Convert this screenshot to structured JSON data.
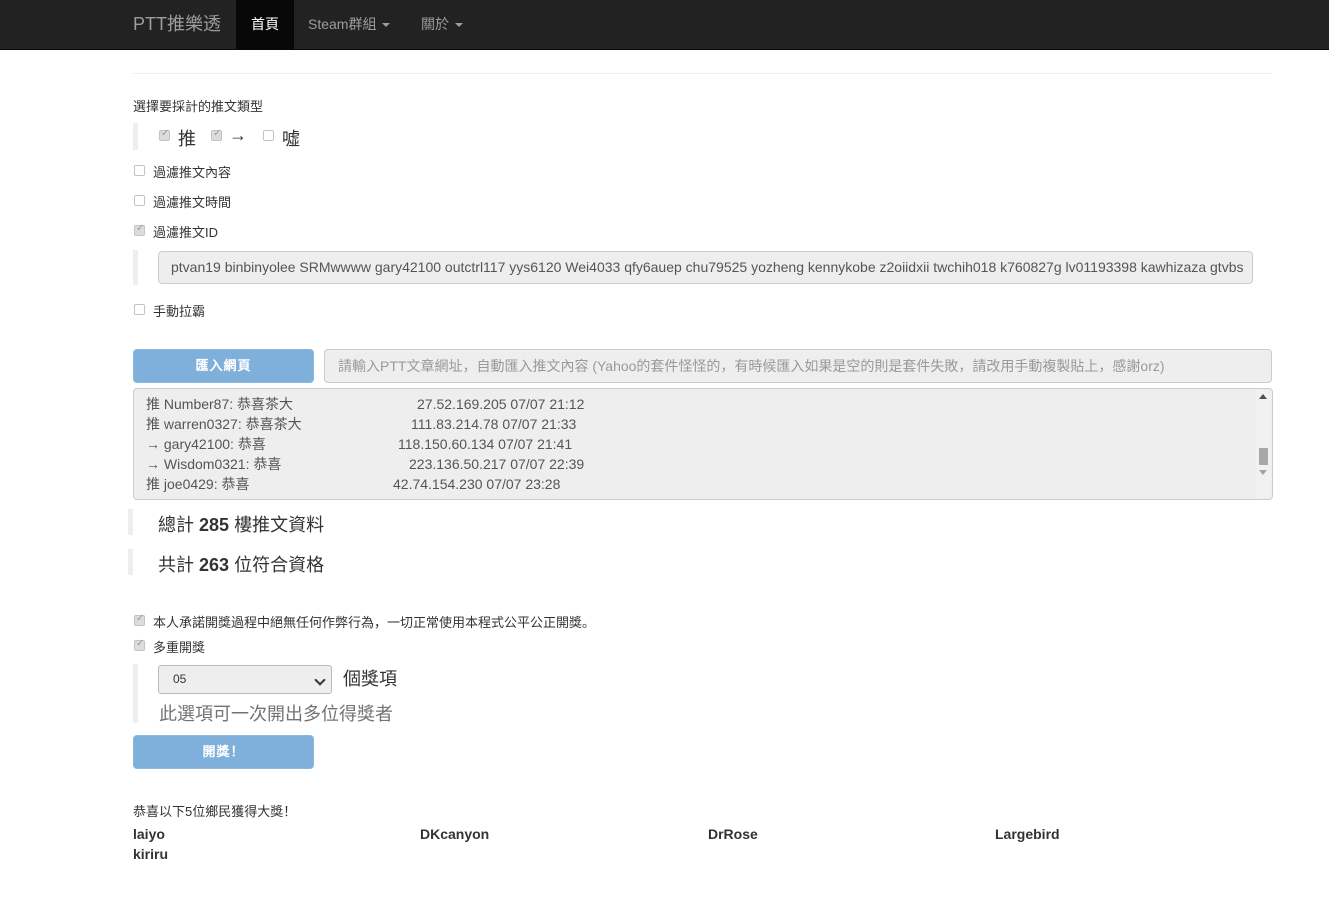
{
  "navbar": {
    "brand": "PTT推樂透",
    "items": [
      {
        "label": "首頁",
        "active": true
      },
      {
        "label": "Steam群組",
        "dropdown": true
      },
      {
        "label": "關於",
        "dropdown": true
      }
    ]
  },
  "push_type": {
    "title": "選擇要採計的推文類型",
    "options": [
      {
        "label": "推",
        "checked": true
      },
      {
        "label": "→",
        "checked": true
      },
      {
        "label": "噓",
        "checked": false
      }
    ]
  },
  "filters": {
    "content": {
      "label": "過濾推文內容",
      "checked": false
    },
    "time": {
      "label": "過濾推文時間",
      "checked": false
    },
    "id": {
      "label": "過濾推文ID",
      "checked": true
    },
    "id_value": "ptvan19 binbinyolee SRMwwww gary42100 outctrl117 yys6120 Wei4033 qfy6auep chu79525 yozheng kennykobe z2oiidxii twchih018 k760827g lv01193398 kawhizaza gtvbs",
    "manual": {
      "label": "手動拉霸",
      "checked": false
    }
  },
  "import": {
    "button_label": "匯入網頁",
    "url_placeholder": "請輸入PTT文章網址，自動匯入推文內容 (Yahoo的套件怪怪的，有時候匯入如果是空的則是套件失敗，請改用手動複製貼上，感謝orz)"
  },
  "comments": [
    {
      "text": "推 Number87: 恭喜茶大",
      "ip": "27.52.169.205 07/07 21:12"
    },
    {
      "text": "推 warren0327: 恭喜茶大",
      "ip": "111.83.214.78 07/07 21:33"
    },
    {
      "text": "→ gary42100: 恭喜",
      "ip": "118.150.60.134 07/07 21:41"
    },
    {
      "text": "→ Wisdom0321: 恭喜",
      "ip": "223.136.50.217 07/07 22:39"
    },
    {
      "text": "推 joe0429: 恭喜",
      "ip": "42.74.154.230 07/07 23:28"
    }
  ],
  "stats": {
    "total_prefix": "總計 ",
    "total_count": "285",
    "total_suffix": " 樓推文資料",
    "eligible_prefix": "共計 ",
    "eligible_count": "263",
    "eligible_suffix": " 位符合資格"
  },
  "draw": {
    "pledge": {
      "label": "本人承諾開獎過程中絕無任何作弊行為，一切正常使用本程式公平公正開獎。",
      "checked": true
    },
    "multi": {
      "label": "多重開獎",
      "checked": true
    },
    "prize_count": "05",
    "prize_suffix": "個獎項",
    "multi_hint": "此選項可一次開出多位得獎者",
    "button_label": "開獎！"
  },
  "results": {
    "title": "恭喜以下5位鄉民獲得大獎！",
    "winners": [
      "laiyo",
      "DKcanyon",
      "DrRose",
      "Largebird",
      "kiriru"
    ]
  }
}
